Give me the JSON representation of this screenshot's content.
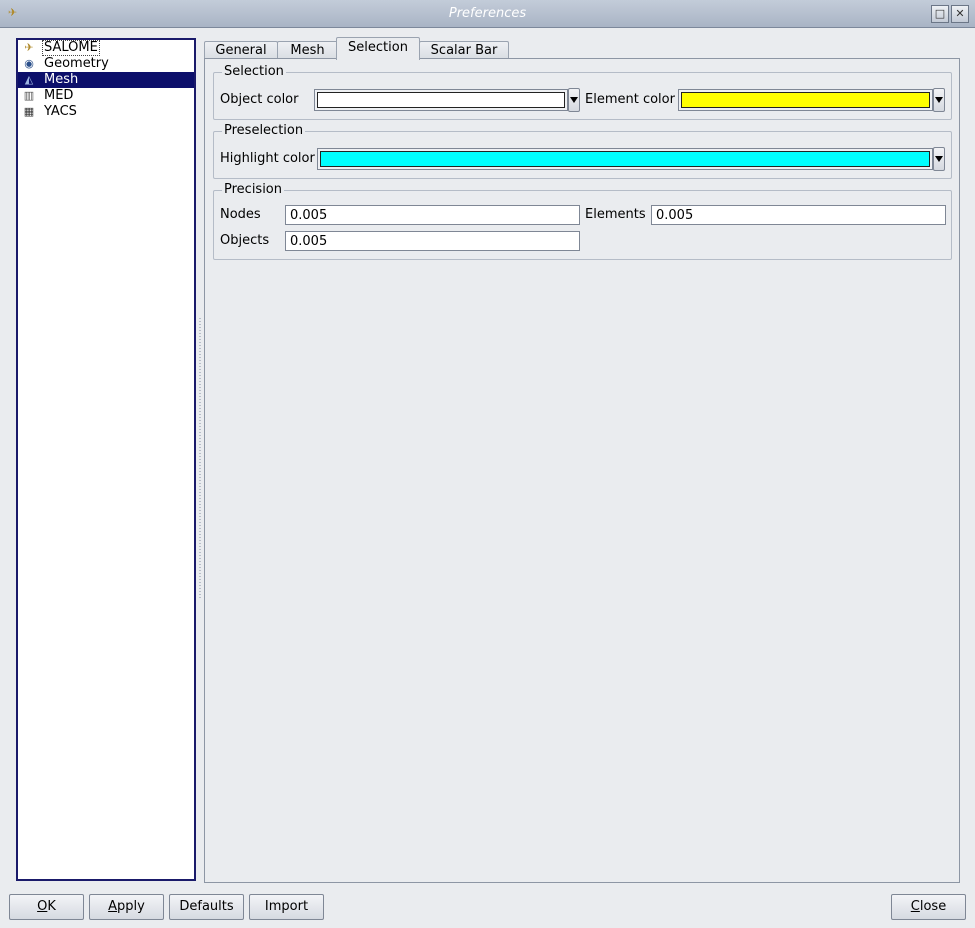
{
  "window": {
    "title": "Preferences",
    "maximize_glyph": "□",
    "close_glyph": "✕"
  },
  "tree": {
    "items": [
      {
        "label": "SALOME",
        "icon": "salome-icon"
      },
      {
        "label": "Geometry",
        "icon": "geometry-icon"
      },
      {
        "label": "Mesh",
        "icon": "mesh-icon"
      },
      {
        "label": "MED",
        "icon": "med-icon"
      },
      {
        "label": "YACS",
        "icon": "yacs-icon"
      }
    ],
    "selected": "Mesh"
  },
  "tabs": [
    "General",
    "Mesh",
    "Selection",
    "Scalar Bar"
  ],
  "active_tab": "Selection",
  "selection": {
    "title": "Selection",
    "object_color_label": "Object color",
    "object_color": "#ffffff",
    "element_color_label": "Element color",
    "element_color": "#ffff00"
  },
  "preselection": {
    "title": "Preselection",
    "highlight_color_label": "Highlight color",
    "highlight_color": "#00ffff"
  },
  "precision": {
    "title": "Precision",
    "nodes_label": "Nodes",
    "nodes_value": "0.005",
    "elements_label": "Elements",
    "elements_value": "0.005",
    "objects_label": "Objects",
    "objects_value": "0.005"
  },
  "buttons": {
    "ok": {
      "mnemonic": "O",
      "rest": "K"
    },
    "apply": {
      "mnemonic": "A",
      "rest": "pply"
    },
    "defaults": "Defaults",
    "import": "Import",
    "close": {
      "mnemonic": "C",
      "rest": "lose"
    }
  }
}
